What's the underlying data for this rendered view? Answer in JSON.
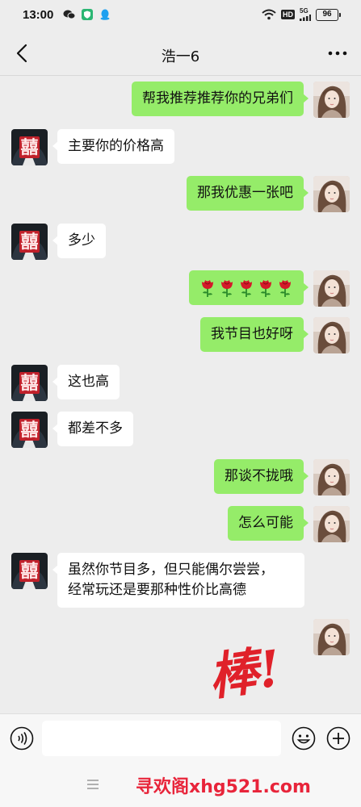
{
  "status_bar": {
    "time": "13:00",
    "hd": "HD",
    "network": "5G",
    "battery": "96"
  },
  "header": {
    "title": "浩一6"
  },
  "messages": [
    {
      "dir": "out",
      "text": "帮我推荐推荐你的兄弟们"
    },
    {
      "dir": "in",
      "text": "主要你的价格高"
    },
    {
      "dir": "out",
      "text": "那我优惠一张吧"
    },
    {
      "dir": "in",
      "text": "多少"
    },
    {
      "dir": "out",
      "type": "emoji",
      "emoji": "rose",
      "count": 5
    },
    {
      "dir": "out",
      "text": "我节目也好呀"
    },
    {
      "dir": "in",
      "text": "这也高"
    },
    {
      "dir": "in",
      "text": "都差不多"
    },
    {
      "dir": "out",
      "text": "那谈不拢哦"
    },
    {
      "dir": "out",
      "text": "怎么可能"
    },
    {
      "dir": "in",
      "text": "虽然你节目多，但只能偶尔尝尝，\n经常玩还是要那种性价比高德"
    },
    {
      "dir": "out",
      "type": "sticker",
      "text": "棒!"
    }
  ],
  "input_bar": {
    "voice_icon": "voice-icon",
    "emoji_icon": "emoji-icon",
    "plus_icon": "plus-icon",
    "placeholder": ""
  },
  "watermark": "寻欢阁xhg521.com",
  "colors": {
    "outgoing_bubble": "#95ec69",
    "incoming_bubble": "#ffffff",
    "background": "#ededed",
    "watermark": "#e8243a",
    "sticker": "#e0212a"
  }
}
